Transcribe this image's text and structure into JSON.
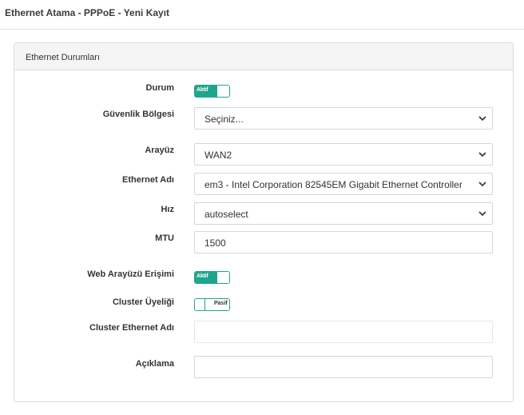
{
  "page": {
    "title": "Ethernet Atama - PPPoE - Yeni Kayıt"
  },
  "panel": {
    "title": "Ethernet Durumları"
  },
  "form": {
    "durum": {
      "label": "Durum",
      "state": "Aktif"
    },
    "guvenlik_bolgesi": {
      "label": "Güvenlik Bölgesi",
      "value": "Seçiniz..."
    },
    "arayuz": {
      "label": "Arayüz",
      "value": "WAN2"
    },
    "ethernet_adi": {
      "label": "Ethernet Adı",
      "value": "em3 - Intel Corporation 82545EM Gigabit Ethernet Controller"
    },
    "hiz": {
      "label": "Hız",
      "value": "autoselect"
    },
    "mtu": {
      "label": "MTU",
      "value": "1500"
    },
    "web_arayuzu": {
      "label": "Web Arayüzü Erişimi",
      "state": "Aktif"
    },
    "cluster_uyeligi": {
      "label": "Cluster Üyeliği",
      "state": "Pasif"
    },
    "cluster_ethernet_adi": {
      "label": "Cluster Ethernet Adı",
      "value": ""
    },
    "aciklama": {
      "label": "Açıklama",
      "value": ""
    }
  },
  "colors": {
    "accent": "#1fa58c"
  }
}
